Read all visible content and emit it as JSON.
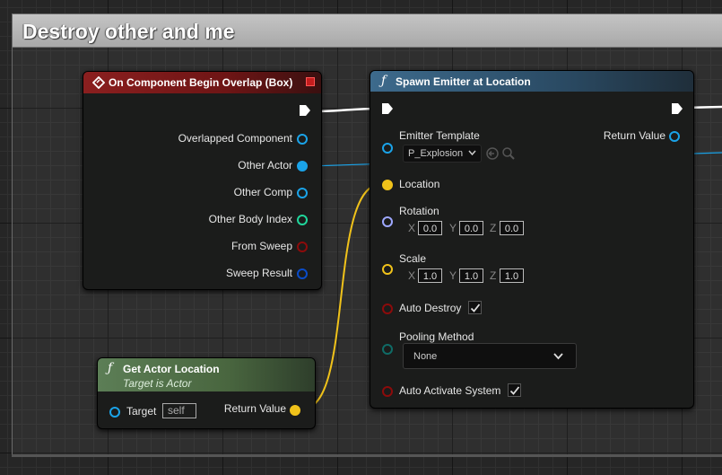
{
  "comment": {
    "title": "Destroy other and me"
  },
  "overlap_node": {
    "title": "On Component Begin Overlap (Box)",
    "pins": [
      "Overlapped Component",
      "Other Actor",
      "Other Comp",
      "Other Body Index",
      "From Sweep",
      "Sweep Result"
    ]
  },
  "spawn_node": {
    "title": "Spawn Emitter at Location",
    "emitter_template_label": "Emitter Template",
    "emitter_template_value": "P_Explosion",
    "return_value_label": "Return Value",
    "location_label": "Location",
    "rotation_label": "Rotation",
    "rotation": {
      "x": "0.0",
      "y": "0.0",
      "z": "0.0"
    },
    "scale_label": "Scale",
    "scale": {
      "x": "1.0",
      "y": "1.0",
      "z": "1.0"
    },
    "axis_labels": {
      "x": "X",
      "y": "Y",
      "z": "Z"
    },
    "auto_destroy_label": "Auto Destroy",
    "auto_destroy": true,
    "pooling_method_label": "Pooling Method",
    "pooling_method_value": "None",
    "auto_activate_label": "Auto Activate System",
    "auto_activate": true
  },
  "get_location_node": {
    "title": "Get Actor Location",
    "subtitle": "Target is Actor",
    "target_label": "Target",
    "target_value": "self",
    "return_value_label": "Return Value"
  },
  "colors": {
    "event_header": "#8b1f1f",
    "function_header": "#3d6a8c",
    "pure_header": "#5c7e56",
    "object_pin": "#1aa3e8",
    "vector_pin": "#f0c21a",
    "rotator_pin": "#9ea8ff",
    "int_pin": "#20d69b",
    "bool_pin": "#8c0b0b",
    "struct_pin": "#0a4cc9",
    "byte_pin": "#0f6b66"
  }
}
